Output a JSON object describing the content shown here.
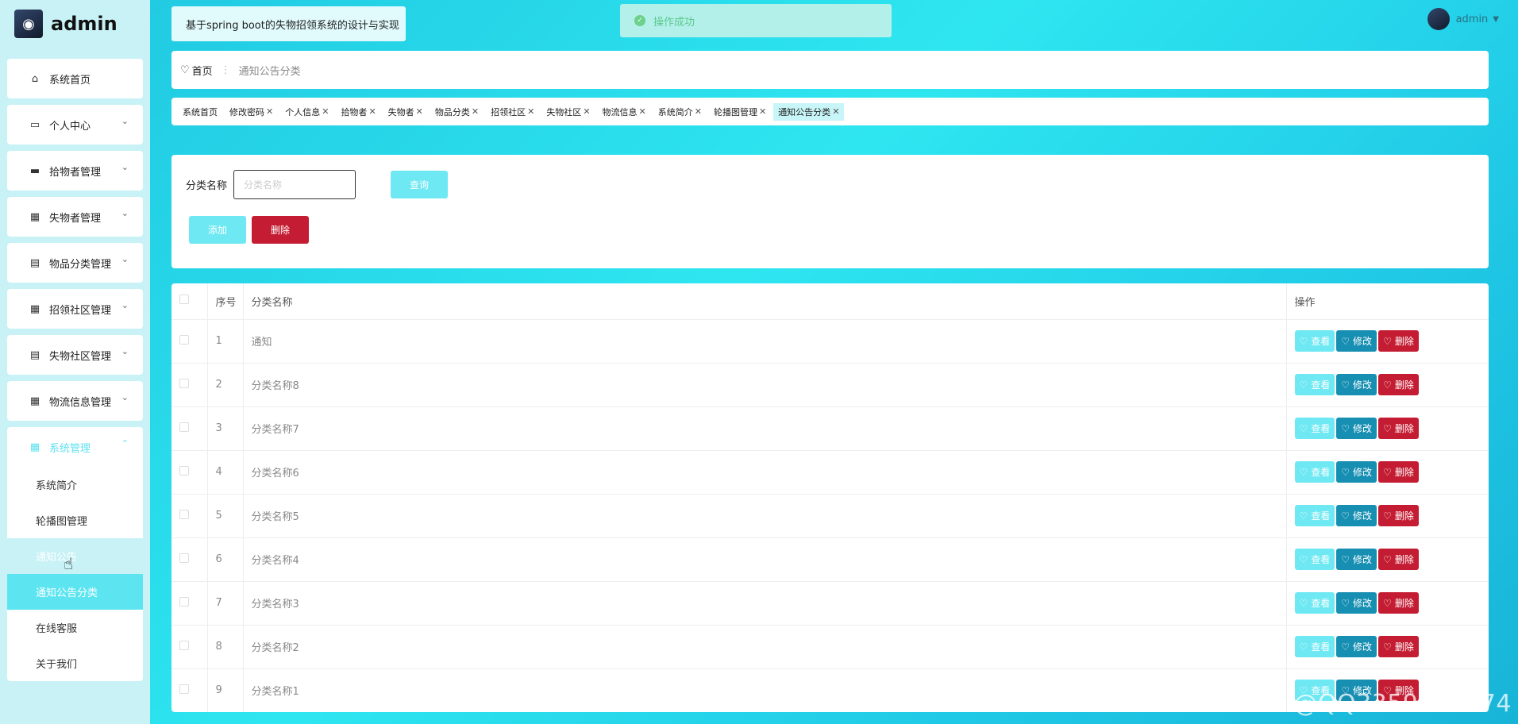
{
  "app": {
    "brand": "admin",
    "site_title": "基于spring boot的失物招领系统的设计与实现"
  },
  "toast": {
    "message": "操作成功"
  },
  "user": {
    "name": "admin"
  },
  "sidebar": {
    "items": [
      {
        "label": "系统首页",
        "icon": "home-icon"
      },
      {
        "label": "个人中心",
        "icon": "id-card-icon"
      },
      {
        "label": "拾物者管理",
        "icon": "briefcase-icon"
      },
      {
        "label": "失物者管理",
        "icon": "grid-icon"
      },
      {
        "label": "物品分类管理",
        "icon": "clipboard-icon"
      },
      {
        "label": "招领社区管理",
        "icon": "grid-icon"
      },
      {
        "label": "失物社区管理",
        "icon": "clipboard-icon"
      },
      {
        "label": "物流信息管理",
        "icon": "grid-icon"
      },
      {
        "label": "系统管理",
        "icon": "apps-icon"
      }
    ],
    "submenu": [
      {
        "label": "系统简介"
      },
      {
        "label": "轮播图管理"
      },
      {
        "label": "通知公告"
      },
      {
        "label": "通知公告分类"
      },
      {
        "label": "在线客服"
      },
      {
        "label": "关于我们"
      }
    ]
  },
  "breadcrumb": {
    "home": "首页",
    "current": "通知公告分类"
  },
  "tags": [
    "系统首页",
    "修改密码",
    "个人信息",
    "拾物者",
    "失物者",
    "物品分类",
    "招领社区",
    "失物社区",
    "物流信息",
    "系统简介",
    "轮播图管理",
    "通知公告分类"
  ],
  "search": {
    "label": "分类名称",
    "placeholder": "分类名称",
    "query_label": "查询",
    "add_label": "添加",
    "delete_label": "删除"
  },
  "table": {
    "headers": {
      "index": "序号",
      "name": "分类名称",
      "ops": "操作"
    },
    "actions": {
      "view": "查看",
      "edit": "修改",
      "delete": "删除"
    },
    "rows": [
      {
        "index": "1",
        "name": "通知"
      },
      {
        "index": "2",
        "name": "分类名称8"
      },
      {
        "index": "3",
        "name": "分类名称7"
      },
      {
        "index": "4",
        "name": "分类名称6"
      },
      {
        "index": "5",
        "name": "分类名称5"
      },
      {
        "index": "6",
        "name": "分类名称4"
      },
      {
        "index": "7",
        "name": "分类名称3"
      },
      {
        "index": "8",
        "name": "分类名称2"
      },
      {
        "index": "9",
        "name": "分类名称1"
      }
    ]
  },
  "watermark": "CSDN @QQ3359892174",
  "colors": {
    "accent": "#5ce5f1",
    "danger": "#c41d33",
    "edit": "#178fb2",
    "sidebar_bg": "#c8f2f6"
  }
}
